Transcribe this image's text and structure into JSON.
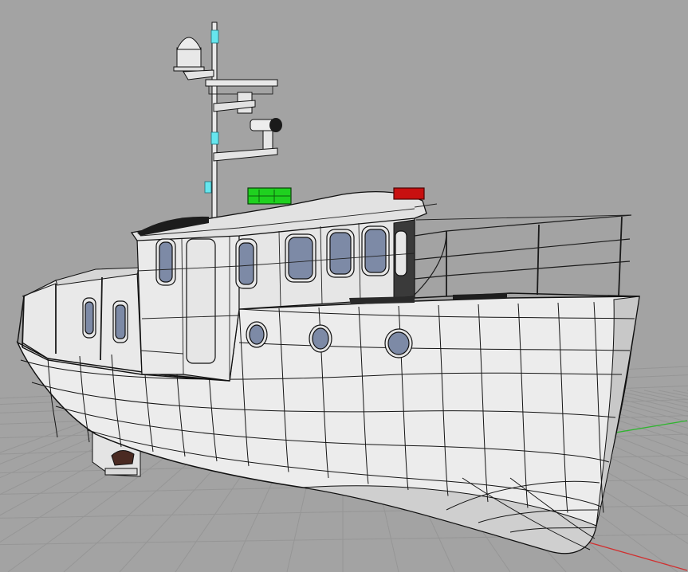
{
  "viewport": {
    "background": "#a3a3a3",
    "grid_color": "#969696",
    "axis_x_color": "#d03030",
    "axis_y_color": "#2fb52f"
  },
  "model": {
    "hull_color": "#ececec",
    "wire_color": "#151515",
    "window_glass_color": "#7d8aa6",
    "starboard_light_color": "#1fd11f",
    "port_light_color": "#c81010",
    "nav_light_color": "#66e6ee",
    "radome_color": "#e8e8e8"
  },
  "icons": {
    "radome": "radome-icon",
    "searchlight": "searchlight-icon"
  }
}
